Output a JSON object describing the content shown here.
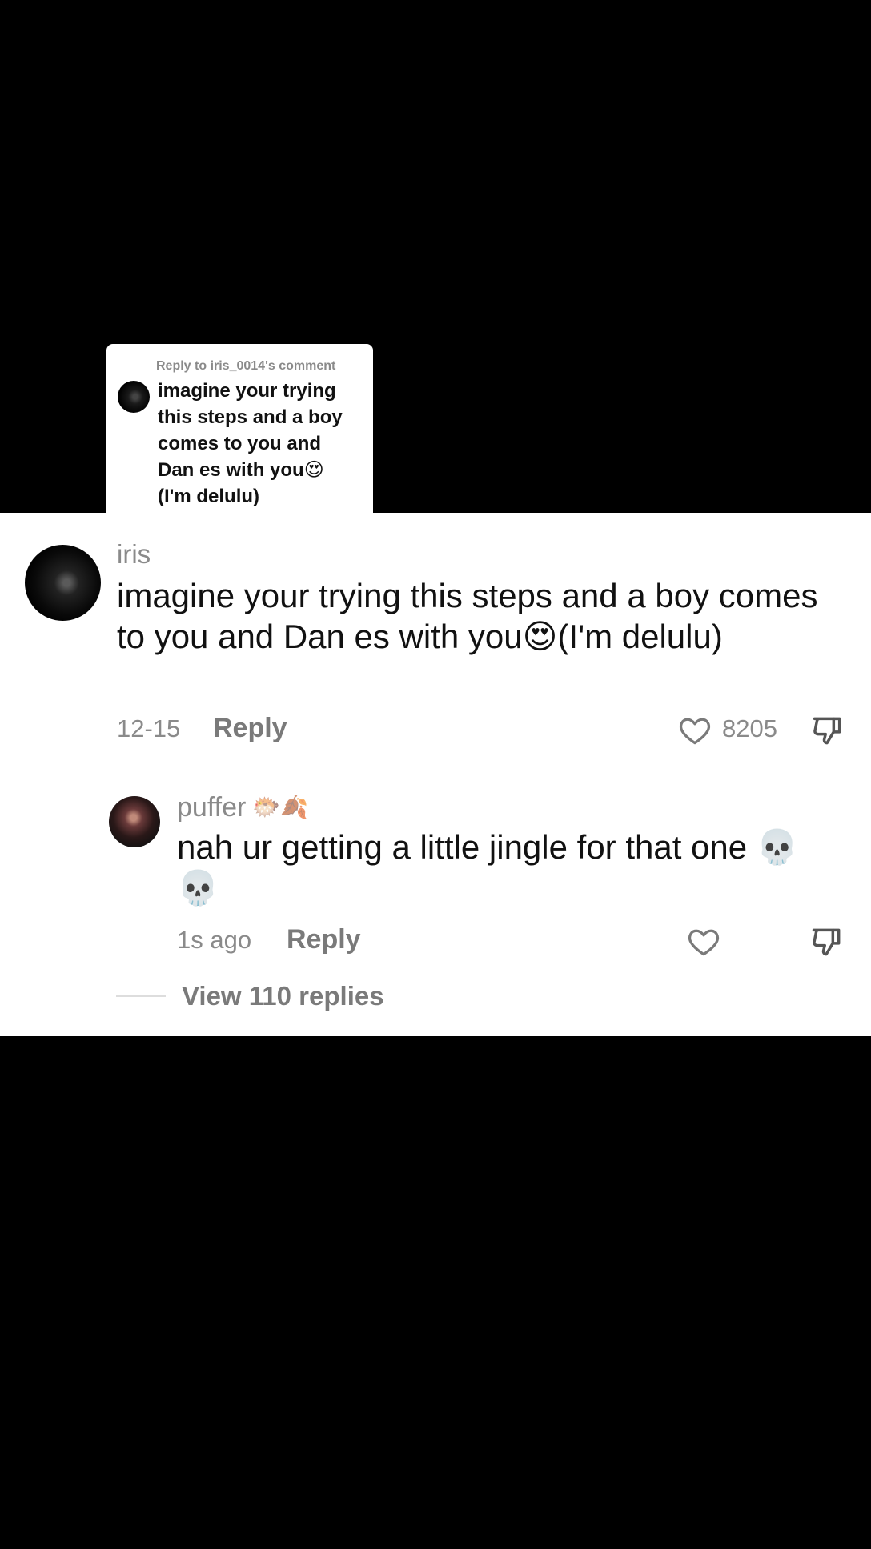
{
  "reply_sticker": {
    "header": "Reply to iris_0014's comment",
    "text": "imagine your trying this steps and a boy comes to you and Dan es with you😍 (I'm delulu)"
  },
  "comment": {
    "username": "iris",
    "text": "imagine your trying this steps and a boy comes to you and Dan es with you😍(I'm delulu)",
    "date": "12-15",
    "reply_label": "Reply",
    "like_count": "8205",
    "icons": {
      "like": "heart-outline-icon",
      "dislike": "thumbs-down-icon"
    }
  },
  "reply": {
    "username": "puffer",
    "badge": "🐡🍂",
    "text": "nah ur getting a little jingle for that one 💀💀",
    "date": "1s ago",
    "reply_label": "Reply"
  },
  "view_replies": "View 110 replies"
}
